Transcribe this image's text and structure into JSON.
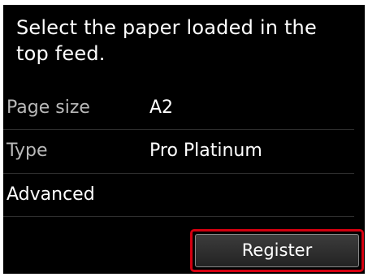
{
  "prompt": {
    "line1": "Select the paper loaded in the",
    "line2": "top feed."
  },
  "settings": {
    "page_size": {
      "label": "Page size",
      "value": "A2"
    },
    "type": {
      "label": "Type",
      "value": "Pro Platinum"
    },
    "advanced": {
      "label": "Advanced"
    }
  },
  "actions": {
    "register_label": "Register"
  },
  "colors": {
    "screen_background": "#000000",
    "text": "#ffffff",
    "dim_label": "#b8b8b8",
    "focus_outline": "#d40010"
  }
}
